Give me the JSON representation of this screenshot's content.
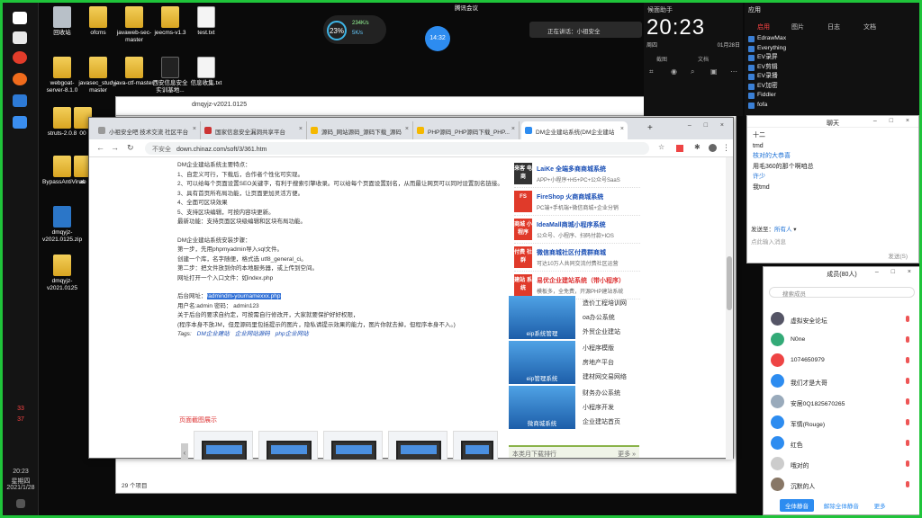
{
  "colors": {
    "accent": "#2d8cf0",
    "desktop_border": "#1fc43a",
    "ad_red": "#e03a2a"
  },
  "taskbar": {
    "tray_counts": [
      "33",
      "37"
    ],
    "time": "20:23",
    "weekday": "星期四",
    "date": "2021/1/28"
  },
  "desktop_icons": [
    {
      "label": "回收站",
      "type": "bin"
    },
    {
      "label": "ofcms",
      "type": "folder"
    },
    {
      "label": "javaweb-sec-master",
      "type": "folder"
    },
    {
      "label": "jeecms-v1.3",
      "type": "folder"
    },
    {
      "label": "test.txt",
      "type": "file"
    },
    {
      "label": "webgoat-server-8.1.0",
      "type": "folder"
    },
    {
      "label": "javasec_study-master",
      "type": "folder"
    },
    {
      "label": "java-ctf-master",
      "type": "folder"
    },
    {
      "label": "西安信息安全实训基地...",
      "type": "file"
    },
    {
      "label": "信息收集.txt",
      "type": "file"
    },
    {
      "label": "struts-2.0.8",
      "type": "folder"
    },
    {
      "label": "00",
      "type": "folder"
    },
    {
      "label": "BypassAntiVirus",
      "type": "folder"
    },
    {
      "label": "ab",
      "type": "folder"
    },
    {
      "label": "dmqyjz-v2021.0125.zip",
      "type": "zip"
    },
    {
      "label": "dmqyjz-v2021.0125",
      "type": "folder"
    }
  ],
  "widgets": {
    "meter_pct": "23",
    "meter_unit": "%",
    "meter_up": "234K/s",
    "meter_down": "5K/s",
    "timer": "14:32",
    "meeting": "腾讯会议",
    "speaker": "正在讲话：小祖安全"
  },
  "clock": {
    "title": "候面助手",
    "time": "20:23",
    "weekday": "周四",
    "date": "01月28日",
    "tools": [
      "截图",
      "文档"
    ]
  },
  "apps": {
    "title": "应用",
    "tabs": [
      "启用",
      "图片",
      "日志",
      "文档"
    ],
    "items": [
      "EdrawMax",
      "Everything",
      "EV录屏",
      "EV剪辑",
      "EV录播",
      "EV加密",
      "Fiddler",
      "fofa"
    ]
  },
  "dm_window": {
    "title": "dmqyjz-v2021.0125"
  },
  "explorer": {
    "status": "29 个项目"
  },
  "browser": {
    "tabs": [
      {
        "label": "小祖安全吧 技术交流 社区平台",
        "active": false
      },
      {
        "label": "国家信息安全漏洞共享平台",
        "active": false
      },
      {
        "label": "源码_网站源码_源码下载_源码",
        "active": false
      },
      {
        "label": "PHP源码_PHP源码下载_PHP...",
        "active": false
      },
      {
        "label": "DM企业建站系统(DM企业建站",
        "active": true
      }
    ],
    "url": "down.chinaz.com/soft/3/361.htm",
    "insecure": "不安全",
    "article": {
      "h1": "DM企业建站系统主要特点：",
      "features": [
        "1、自定义可行，下载后，合作者个性化可实现。",
        "2、可以给每个页面设置SEO关键字，有利于搜索引擎收录。可以给每个页面设置别名，从而最让网页可以同时设置别名链接。",
        "3、具有首页所布局功能，让页面更加灵活方便。",
        "4、全面可区块效果",
        "5、支持区块编辑，可按内容块更新。",
        "最新功能：支持页面区块级编辑和区块布局功能。"
      ],
      "h2": "DM企业建站系统安装步骤：",
      "steps": [
        "第一步，先用phpmyadmin导入sql文件。",
        "创建一个库，名字随便，格式选 utf8_general_ci。",
        "第二步：把文件放到你的本地服务器，或上传到空间。",
        "网址打开一个入口文件：如index.php"
      ],
      "admin_label": "后台网址：",
      "admin_url": "/admindm-yournamexxx.php",
      "account": "用户名:admin  密码： admin123",
      "notes": [
        "关于后台的要求自约定，可按需自行修改开，大家就要保护好好权限，",
        "(程序本身不放JM，但是源码里包括提示的图片，隐私请提示效果的能力，图片你就去掉，但程序本身不入。)"
      ],
      "tags_label": "Tags:",
      "tags": [
        "DM企业建站",
        "企业网站源码",
        "php企业网站"
      ],
      "shots_title": "页面截图展示"
    },
    "ads": [
      {
        "logo": "来客\n电商",
        "title": "LaiKe 全端多商商城系统",
        "desc": "APP+小程序+H5+PC+公众号SaaS",
        "color": "#333"
      },
      {
        "logo": "FS",
        "title": "FireShop 火商商城系统",
        "desc": "PC端+手机端+微信商城+企业分销",
        "color": "#e03a2a"
      },
      {
        "logo": "商城\n小程序",
        "title": "IdeaMall商城小程序系统",
        "desc": "公众号、小程序、扫码付款+IOS",
        "color": "#e03a2a"
      },
      {
        "logo": "付费\n社群",
        "title": "微信商城社区付费群商城",
        "desc": "可达10万人共同交流付费社区运营",
        "color": "#e03a2a"
      },
      {
        "logo": "建站\n系统",
        "title": "易优企业建站系统（带小程序）",
        "desc": "模板多，全免费，开源PHP建站系统",
        "color": "#e03a2a"
      }
    ],
    "thumbs": [
      {
        "caption": "eip系统管理",
        "links": [
          "造价工程培训网",
          "oa办公系统",
          "外贸企业建站"
        ]
      },
      {
        "caption": "eip管理系统",
        "links": [
          "小程序模版",
          "房地产平台",
          "建材网交易网络"
        ]
      },
      {
        "caption": "微商城系统",
        "links": [
          "财务办公系统",
          "小程序开发",
          "企业建站首页"
        ]
      }
    ],
    "rank": {
      "label": "本类月下载排行",
      "more": "更多 »"
    }
  },
  "chat": {
    "title": "聊天",
    "messages": [
      "十二",
      "tmd",
      "核对的大恭喜",
      "用毛360的那个啊咱总",
      "许少",
      "我tmd"
    ],
    "send_to_label": "发送至：",
    "send_to": "所有人",
    "placeholder": "点此输入消息",
    "send_button": "发送(S)"
  },
  "members": {
    "title": "成员(80人)",
    "search_placeholder": "搜索成员",
    "list": [
      "虚拟安全论坛",
      "N0ne",
      "1074650979",
      "我们才是大哥",
      "安居0Q1825670265",
      "军情(Rouge)",
      "红色",
      "哦对的",
      "沉默的人"
    ],
    "buttons": [
      "全体静音",
      "解除全体静音",
      "更多"
    ]
  }
}
